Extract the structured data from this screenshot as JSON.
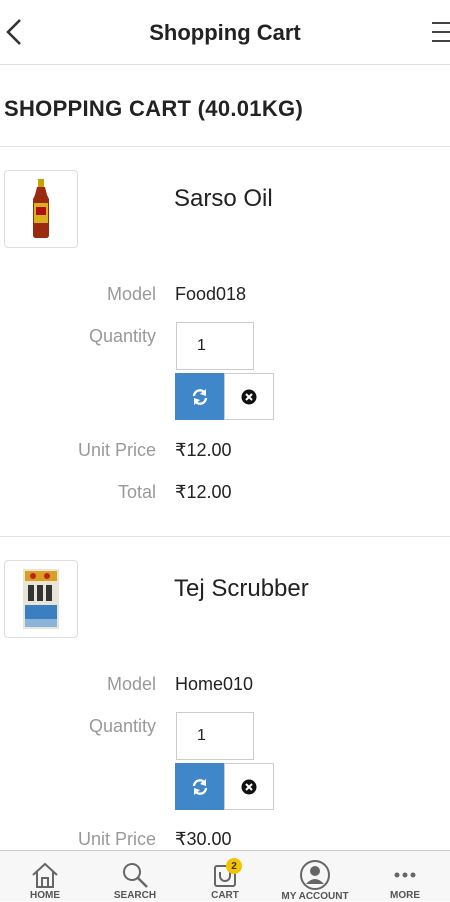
{
  "header": {
    "title": "Shopping Cart"
  },
  "cart": {
    "heading": "SHOPPING CART  (40.01KG)"
  },
  "labels": {
    "model": "Model",
    "quantity": "Quantity",
    "unit_price": "Unit Price",
    "total": "Total"
  },
  "items": [
    {
      "name": "Sarso Oil",
      "model": "Food018",
      "quantity": "1",
      "unit_price": "₹12.00",
      "total": "₹12.00"
    },
    {
      "name": "Tej Scrubber",
      "model": "Home010",
      "quantity": "1",
      "unit_price": "₹30.00"
    }
  ],
  "tabbar": {
    "tabs": [
      {
        "label": "HOME",
        "icon": "home-icon"
      },
      {
        "label": "SEARCH",
        "icon": "search-icon"
      },
      {
        "label": "CART",
        "icon": "cart-icon",
        "badge": "2"
      },
      {
        "label": "MY ACCOUNT",
        "icon": "account-icon"
      },
      {
        "label": "MORE",
        "icon": "more-icon"
      }
    ]
  },
  "colors": {
    "accent": "#3f87c9",
    "badge": "#f5c400"
  }
}
